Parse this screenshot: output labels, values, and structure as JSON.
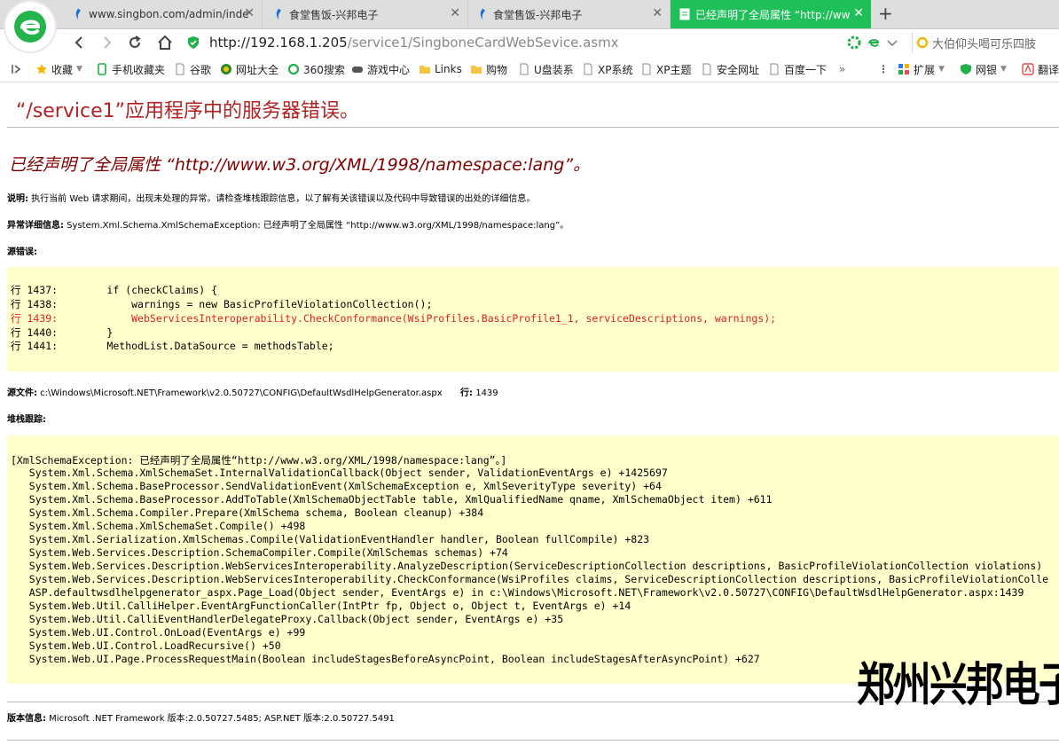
{
  "browser": {
    "tabs": [
      {
        "title": "www.singbon.com/admin/inde",
        "active": false
      },
      {
        "title": "食堂售饭-兴邦电子",
        "active": false
      },
      {
        "title": "食堂售饭-兴邦电子",
        "active": false
      },
      {
        "title": "已经声明了全局属性 “http://ww",
        "active": true
      }
    ],
    "url_host": "http://192.168.1.205",
    "url_path": "/service1/SingboneCardWebSevice.asmx",
    "search_text": "大伯仰头喝可乐四肢",
    "bookmarks": [
      "收藏",
      "手机收藏夹",
      "谷歌",
      "网址大全",
      "360搜索",
      "游戏中心",
      "Links",
      "购物",
      "U盘装系",
      "XP系统",
      "XP主题",
      "安全网址",
      "百度一下"
    ],
    "extras": [
      "扩展",
      "网银",
      "翻译"
    ],
    "more_glyph": "»"
  },
  "page": {
    "title": "“/service1”应用程序中的服务器错误。",
    "error_message": "已经声明了全局属性 “http://www.w3.org/XML/1998/namespace:lang”。",
    "description_label": "说明:",
    "description_text": " 执行当前 Web 请求期间，出现未处理的异常。请检查堆栈跟踪信息，以了解有关该错误以及代码中导致错误的出处的详细信息。",
    "exception_label": "异常详细信息:",
    "exception_text": " System.Xml.Schema.XmlSchemaException: 已经声明了全局属性 “http://www.w3.org/XML/1998/namespace:lang”。",
    "source_error_label": "源错误:",
    "source_lines": [
      {
        "text": "行 1437:        if (checkClaims) {",
        "error": false
      },
      {
        "text": "行 1438:            warnings = new BasicProfileViolationCollection();",
        "error": false
      },
      {
        "text": "行 1439:            WebServicesInteroperability.CheckConformance(WsiProfiles.BasicProfile1_1, serviceDescriptions, warnings);",
        "error": true
      },
      {
        "text": "行 1440:        }",
        "error": false
      },
      {
        "text": "行 1441:        MethodList.DataSource = methodsTable;",
        "error": false
      }
    ],
    "source_file_label": "源文件:",
    "source_file_path": " c:\\Windows\\Microsoft.NET\\Framework\\v2.0.50727\\CONFIG\\DefaultWsdlHelpGenerator.aspx",
    "line_label": "行:",
    "line_number": " 1439",
    "stack_label": "堆栈跟踪:",
    "stack_lines": [
      "[XmlSchemaException: 已经声明了全局属性“http://www.w3.org/XML/1998/namespace:lang”。]",
      "   System.Xml.Schema.XmlSchemaSet.InternalValidationCallback(Object sender, ValidationEventArgs e) +1425697",
      "   System.Xml.Schema.BaseProcessor.SendValidationEvent(XmlSchemaException e, XmlSeverityType severity) +64",
      "   System.Xml.Schema.BaseProcessor.AddToTable(XmlSchemaObjectTable table, XmlQualifiedName qname, XmlSchemaObject item) +611",
      "   System.Xml.Schema.Compiler.Prepare(XmlSchema schema, Boolean cleanup) +384",
      "   System.Xml.Schema.XmlSchemaSet.Compile() +498",
      "   System.Xml.Serialization.XmlSchemas.Compile(ValidationEventHandler handler, Boolean fullCompile) +823",
      "   System.Web.Services.Description.SchemaCompiler.Compile(XmlSchemas schemas) +74",
      "   System.Web.Services.Description.WebServicesInteroperability.AnalyzeDescription(ServiceDescriptionCollection descriptions, BasicProfileViolationCollection violations)",
      "   System.Web.Services.Description.WebServicesInteroperability.CheckConformance(WsiProfiles claims, ServiceDescriptionCollection descriptions, BasicProfileViolationColle",
      "   ASP.defaultwsdlhelpgenerator_aspx.Page_Load(Object sender, EventArgs e) in c:\\Windows\\Microsoft.NET\\Framework\\v2.0.50727\\CONFIG\\DefaultWsdlHelpGenerator.aspx:1439",
      "   System.Web.Util.CalliHelper.EventArgFunctionCaller(IntPtr fp, Object o, Object t, EventArgs e) +14",
      "   System.Web.Util.CalliEventHandlerDelegateProxy.Callback(Object sender, EventArgs e) +35",
      "   System.Web.UI.Control.OnLoad(EventArgs e) +99",
      "   System.Web.UI.Control.LoadRecursive() +50",
      "   System.Web.UI.Page.ProcessRequestMain(Boolean includeStagesBeforeAsyncPoint, Boolean includeStagesAfterAsyncPoint) +627"
    ],
    "version_label": "版本信息:",
    "version_text": " Microsoft .NET Framework 版本:2.0.50727.5485; ASP.NET 版本:2.0.50727.5491"
  },
  "watermark": "郑州兴邦电子",
  "colors": {
    "active_tab": "#1fc05a",
    "title_red": "#b22222",
    "message_maroon": "#800000",
    "code_bg": "#ffffcc",
    "error_line": "#e02020"
  }
}
